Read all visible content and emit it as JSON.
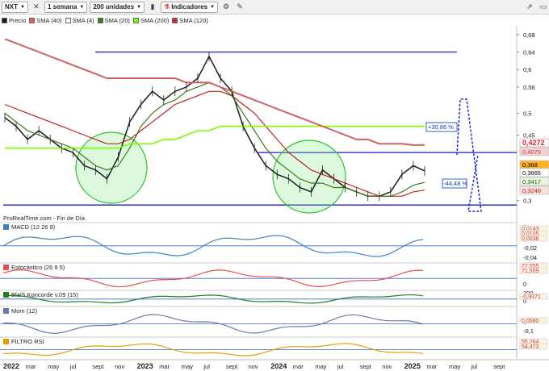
{
  "toolbar": {
    "symbol": "NXT",
    "period": "1 semana",
    "units": "200 unidades",
    "indicators": "Indicadores"
  },
  "legend": [
    {
      "label": "Precio",
      "color": "#1a1a1a"
    },
    {
      "label": "SMA (40)",
      "color": "#e06060"
    },
    {
      "label": "SMA (4)",
      "color": "#ffffff"
    },
    {
      "label": "SMA (20)",
      "color": "#3a7a1a"
    },
    {
      "label": "SMA (200)",
      "color": "#7cfc00"
    },
    {
      "label": "SMA (120)",
      "color": "#c83030"
    }
  ],
  "credit": "ProRealTime.com - Fin de Día",
  "price_axis": {
    "ticks": [
      "0,68",
      "0,64",
      "0,6",
      "0,56",
      "0,5",
      "0,45",
      "0,3"
    ],
    "labels": [
      {
        "text": "0,4272",
        "color": "#e02020",
        "bg": "#ffffff"
      },
      {
        "text": "0,4075",
        "color": "#c04040",
        "bg": "#f4d0d0"
      },
      {
        "text": "0,368",
        "color": "#000000",
        "bg": "#ffb020"
      },
      {
        "text": "0,3665",
        "color": "#000000",
        "bg": "#ffffff"
      },
      {
        "text": "0,3417",
        "color": "#2a5a10",
        "bg": "#e8f4e0"
      },
      {
        "text": "0,3240",
        "color": "#c02020",
        "bg": "#f8e0e0"
      }
    ]
  },
  "annotations": {
    "pct_up": "+30,86 %",
    "pct_down": "-44,48 %"
  },
  "panels": [
    {
      "title": "MACD (12 26 9)",
      "ticks": [
        "0",
        "-0,02",
        "-0,04"
      ],
      "labels": [
        "0,0143",
        "0,0105",
        "0,0038"
      ]
    },
    {
      "title": "Estocástico (26 8 5)",
      "ticks": [
        "0"
      ],
      "labels": [
        "72,055",
        "71,509"
      ]
    },
    {
      "title": "BlaiS Koncorde v.09 (15)",
      "ticks": [
        "200",
        "0"
      ],
      "labels": [
        "-0,9371"
      ]
    },
    {
      "title": "Mom (12)",
      "ticks": [
        "0",
        "-0,1"
      ],
      "labels": [
        "0,0580"
      ]
    },
    {
      "title": "FILTRO RSI",
      "ticks": [],
      "labels": [
        "55,264",
        "54,473"
      ]
    }
  ],
  "time_axis": [
    "2022",
    "mar",
    "may",
    "jul",
    "sept",
    "nov",
    "2023",
    "mar",
    "may",
    "jul",
    "sept",
    "nov",
    "2024",
    "mar",
    "may",
    "jul",
    "sept",
    "nov",
    "2025",
    "mar",
    "may",
    "jul",
    "sept"
  ],
  "chart_data": {
    "type": "line",
    "title": "NXT",
    "price_axis": [
      0.27,
      0.7
    ],
    "x": [
      "2022-01",
      "2022-02",
      "2022-03",
      "2022-04",
      "2022-05",
      "2022-06",
      "2022-07",
      "2022-08",
      "2022-09",
      "2022-10",
      "2022-11",
      "2022-12",
      "2023-01",
      "2023-02",
      "2023-03",
      "2023-04",
      "2023-05",
      "2023-06",
      "2023-07",
      "2023-08",
      "2023-09",
      "2023-10",
      "2023-11",
      "2023-12",
      "2024-01",
      "2024-02",
      "2024-03",
      "2024-04",
      "2024-05",
      "2024-06",
      "2024-07",
      "2024-08",
      "2024-09",
      "2024-10",
      "2024-11",
      "2024-12",
      "2025-01",
      "2025-02"
    ],
    "series": [
      {
        "name": "Precio",
        "values": [
          0.49,
          0.47,
          0.44,
          0.46,
          0.44,
          0.42,
          0.41,
          0.38,
          0.37,
          0.35,
          0.4,
          0.48,
          0.52,
          0.55,
          0.53,
          0.55,
          0.56,
          0.58,
          0.63,
          0.58,
          0.55,
          0.47,
          0.42,
          0.38,
          0.36,
          0.35,
          0.33,
          0.32,
          0.37,
          0.35,
          0.33,
          0.32,
          0.31,
          0.31,
          0.32,
          0.36,
          0.38,
          0.368
        ]
      },
      {
        "name": "SMA (40)",
        "values": [
          0.52,
          0.51,
          0.5,
          0.49,
          0.48,
          0.47,
          0.46,
          0.45,
          0.44,
          0.43,
          0.43,
          0.44,
          0.46,
          0.48,
          0.5,
          0.52,
          0.53,
          0.54,
          0.55,
          0.55,
          0.54,
          0.52,
          0.5,
          0.47,
          0.44,
          0.41,
          0.39,
          0.37,
          0.36,
          0.35,
          0.34,
          0.33,
          0.32,
          0.31,
          0.31,
          0.31,
          0.32,
          0.324
        ]
      },
      {
        "name": "SMA (20)",
        "values": [
          0.5,
          0.48,
          0.46,
          0.45,
          0.44,
          0.43,
          0.42,
          0.4,
          0.38,
          0.37,
          0.38,
          0.42,
          0.47,
          0.5,
          0.52,
          0.53,
          0.55,
          0.56,
          0.57,
          0.56,
          0.54,
          0.5,
          0.46,
          0.42,
          0.39,
          0.37,
          0.35,
          0.34,
          0.34,
          0.33,
          0.33,
          0.32,
          0.31,
          0.31,
          0.31,
          0.32,
          0.335,
          0.3417
        ]
      },
      {
        "name": "SMA (200)",
        "values": [
          0.42,
          0.42,
          0.42,
          0.42,
          0.42,
          0.42,
          0.42,
          0.42,
          0.42,
          0.42,
          0.42,
          0.43,
          0.43,
          0.43,
          0.44,
          0.44,
          0.45,
          0.46,
          0.46,
          0.47,
          0.47,
          0.47,
          0.47,
          0.47,
          0.47,
          0.47,
          0.47,
          0.47,
          0.47,
          0.47,
          0.47,
          0.47,
          0.47,
          0.47,
          0.47,
          0.47,
          0.47,
          0.47
        ]
      },
      {
        "name": "SMA (120)",
        "values": [
          0.67,
          0.66,
          0.65,
          0.64,
          0.63,
          0.62,
          0.61,
          0.6,
          0.59,
          0.58,
          0.58,
          0.58,
          0.58,
          0.58,
          0.58,
          0.58,
          0.57,
          0.57,
          0.57,
          0.56,
          0.55,
          0.54,
          0.53,
          0.52,
          0.51,
          0.5,
          0.49,
          0.48,
          0.47,
          0.46,
          0.45,
          0.44,
          0.44,
          0.43,
          0.43,
          0.43,
          0.427,
          0.4272
        ]
      }
    ],
    "levels": [
      0.64,
      0.41,
      0.29
    ]
  }
}
